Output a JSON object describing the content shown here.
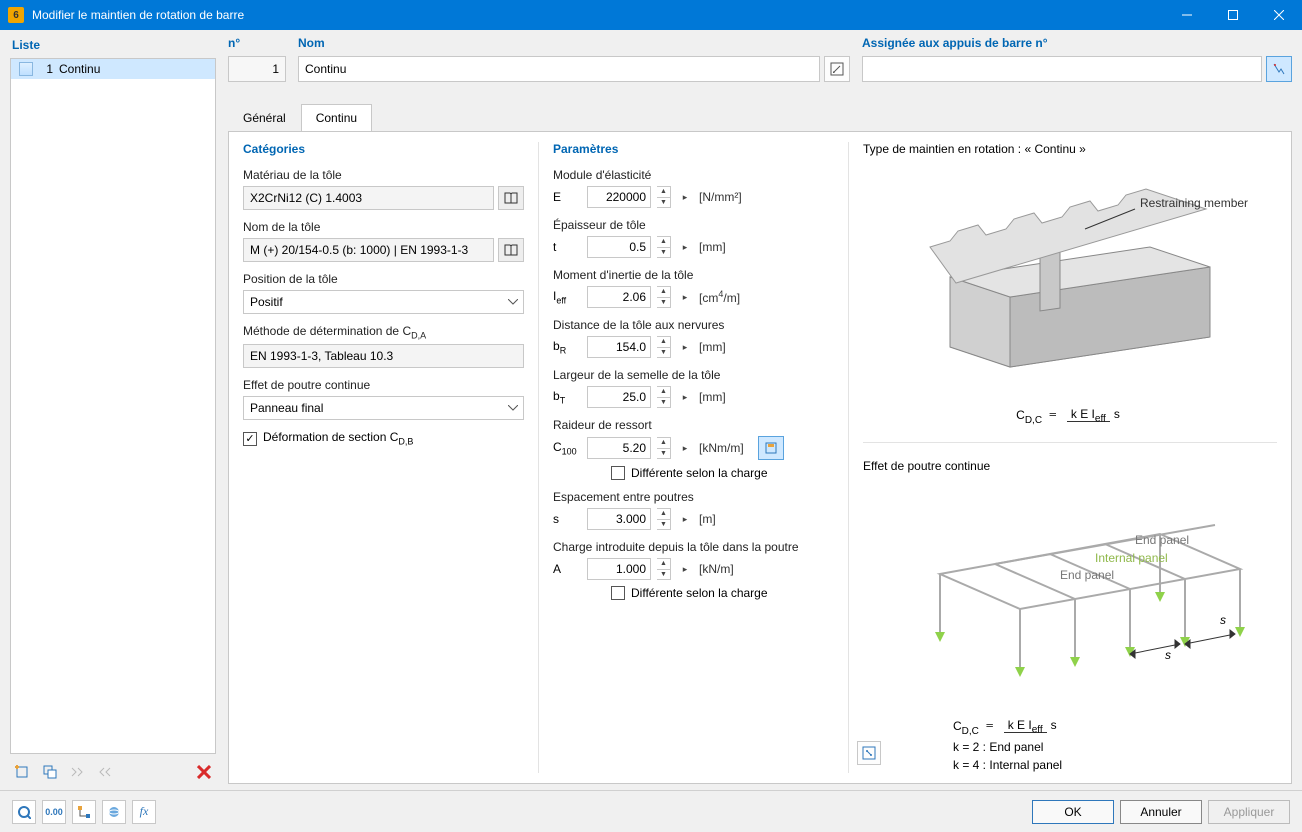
{
  "window": {
    "title": "Modifier le maintien de rotation de barre",
    "app_icon_text": "6"
  },
  "list": {
    "header": "Liste",
    "items": [
      {
        "num": "1",
        "label": "Continu"
      }
    ]
  },
  "top": {
    "num_label": "n°",
    "num_value": "1",
    "name_label": "Nom",
    "name_value": "Continu",
    "assign_label": "Assignée aux appuis de barre n°",
    "assign_value": ""
  },
  "tabs": {
    "general": "Général",
    "continu": "Continu"
  },
  "categories": {
    "title": "Catégories",
    "material_label": "Matériau de la tôle",
    "material_value": "X2CrNi12 (C) 1.4003",
    "sheet_name_label": "Nom de la tôle",
    "sheet_name_value": "M (+) 20/154-0.5 (b: 1000) | EN 1993-1-3",
    "position_label": "Position de la tôle",
    "position_value": "Positif",
    "method_label": "Méthode de détermination de C",
    "method_sub": "D,A",
    "method_value": "EN 1993-1-3, Tableau 10.3",
    "beam_label": "Effet de poutre continue",
    "beam_value": "Panneau final",
    "deform_label": "Déformation de section C",
    "deform_sub": "D,B",
    "deform_checked": true
  },
  "params": {
    "title": "Paramètres",
    "modulus_label": "Module d'élasticité",
    "E_sym": "E",
    "E_val": "220000",
    "E_unit": "[N/mm²]",
    "thick_label": "Épaisseur de tôle",
    "t_sym": "t",
    "t_val": "0.5",
    "t_unit": "[mm]",
    "inertia_label": "Moment d'inertie de la tôle",
    "Ieff_sym": "I",
    "Ieff_sub": "eff",
    "Ieff_val": "2.06",
    "Ieff_unit_pre": "[cm",
    "Ieff_unit_sup": "4",
    "Ieff_unit_post": "/m]",
    "dist_label": "Distance de la tôle aux nervures",
    "bR_sym": "b",
    "bR_sub": "R",
    "bR_val": "154.0",
    "bR_unit": "[mm]",
    "width_label": "Largeur de la semelle de la tôle",
    "bT_sym": "b",
    "bT_sub": "T",
    "bT_val": "25.0",
    "bT_unit": "[mm]",
    "spring_label": "Raideur de ressort",
    "C100_sym": "C",
    "C100_sub": "100",
    "C100_val": "5.20",
    "C100_unit": "[kNm/m]",
    "diff_load": "Différente selon la charge",
    "spacing_label": "Espacement entre poutres",
    "s_sym": "s",
    "s_val": "3.000",
    "s_unit": "[m]",
    "charge_label": "Charge introduite depuis la tôle dans la poutre",
    "A_sym": "A",
    "A_val": "1.000",
    "A_unit": "[kN/m]"
  },
  "illus": {
    "title1_prefix": "Type de maintien en rotation :",
    "title1_value": "« Continu »",
    "restrain": "Restraining member",
    "formula_lhs": "C",
    "formula_lhs_sub": "D,C",
    "formula_top": "k E I",
    "formula_top_sub": "eff",
    "formula_bot": "s",
    "title2": "Effet de poutre continue",
    "end_panel": "End panel",
    "internal_panel": "Internal panel",
    "k2_prefix": "k  =  2 : ",
    "k2_val": "End  panel",
    "k4_prefix": "k  =  4 : ",
    "k4_val": "Internal  panel",
    "s_letter": "s"
  },
  "bottom": {
    "ok": "OK",
    "cancel": "Annuler",
    "apply": "Appliquer"
  }
}
